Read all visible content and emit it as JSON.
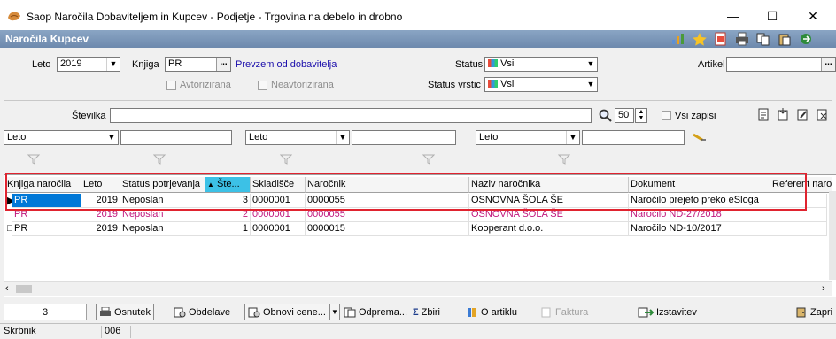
{
  "window": {
    "title": "Saop  Naročila Dobaviteljem in Kupcev - Podjetje - Trgovina na debelo in drobno"
  },
  "header": {
    "title": "Naročila Kupcev"
  },
  "form": {
    "leto_label": "Leto",
    "leto_value": "2019",
    "knjiga_label": "Knjiga",
    "knjiga_value": "PR",
    "prevzem_link": "Prevzem od dobavitelja",
    "avtorizirana_label": "Avtorizirana",
    "neavtorizirana_label": "Neavtorizirana",
    "status_label": "Status",
    "status_value": "Vsi",
    "status_vrstic_label": "Status vrstic",
    "status_vrstic_value": "Vsi",
    "artikel_label": "Artikel",
    "artikel_value": "",
    "stevilka_label": "Številka",
    "stevilka_value": "",
    "count_value": "50",
    "vsi_zapisi_label": "Vsi zapisi",
    "filter1": "Leto",
    "filter2": "Leto",
    "filter3": "Leto"
  },
  "grid": {
    "columns": [
      "Knjiga naročila",
      "Leto",
      "Status potrjevanja",
      "Šte...",
      "Skladišče",
      "Naročnik",
      "Naziv naročnika",
      "Dokument",
      "Referent naro"
    ],
    "sort_column": "Šte...",
    "rows": [
      {
        "knjiga": "PR",
        "leto": "2019",
        "status": "Neposlan",
        "st": "3",
        "skladisce": "0000001",
        "narocnik": "0000055",
        "naziv": "OSNOVNA ŠOLA ŠE",
        "dokument": "Naročilo prejeto preko eSloga",
        "referent": ""
      },
      {
        "knjiga": "PR",
        "leto": "2019",
        "status": "Neposlan",
        "st": "2",
        "skladisce": "0000001",
        "narocnik": "0000055",
        "naziv": "OSNOVNA ŠOLA ŠE",
        "dokument": "Naročilo ND-27/2018",
        "referent": ""
      },
      {
        "knjiga": "PR",
        "leto": "2019",
        "status": "Neposlan",
        "st": "1",
        "skladisce": "0000001",
        "narocnik": "0000015",
        "naziv": "Kooperant d.o.o.",
        "dokument": "Naročilo ND-10/2017",
        "referent": ""
      }
    ]
  },
  "toolbar": {
    "count": "3",
    "osnutek": "Osnutek",
    "obdelave": "Obdelave",
    "obnovi_cene": "Obnovi cene...",
    "odprema": "Odprema...",
    "zbiri": "Zbiri",
    "o_artiklu": "O artiklu",
    "faktura": "Faktura",
    "izstavitev": "Izstavitev",
    "zapri": "Zapri"
  },
  "statusbar": {
    "user": "Skrbnik",
    "code": "006"
  },
  "colors": {
    "header_bg": "#7993b6",
    "highlight": "#e0232f",
    "selected_cell": "#0078d7",
    "magenta_row": "#c0187d"
  }
}
